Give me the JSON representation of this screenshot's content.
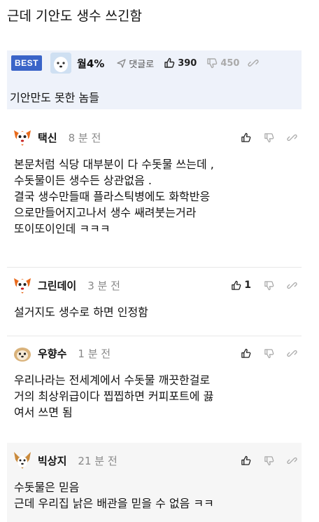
{
  "post": {
    "title": "근데 기안도 생수 쓰긴함"
  },
  "best": {
    "badge": "BEST",
    "nickname": "월4%",
    "reply_label": "댓글로",
    "upvotes": "390",
    "downvotes": "450",
    "body": "기안만도 못한 놈들"
  },
  "comments": [
    {
      "nickname": "택신",
      "time": "8 분 전",
      "upvotes": "",
      "lines": [
        "본문처럼 식당 대부분이 다 수돗물 쓰는데 ,",
        "수돗물이든 생수든 상관없음 .",
        "결국 생수만들때 플라스틱병에도 화학반응",
        "으로만들어지고나서 생수 쌔려붓는거라",
        "또이또이인데 ㅋㅋㅋ"
      ]
    },
    {
      "nickname": "그린데이",
      "time": "3 분 전",
      "upvotes": "1",
      "lines": [
        "설거지도 생수로 하면 인정함"
      ]
    },
    {
      "nickname": "우향수",
      "time": "1 분 전",
      "upvotes": "",
      "lines": [
        "우리나라는 전세계에서 수돗물 깨끗한걸로",
        "거의 최상위급이다 찝찝하면 커피포트에 끓",
        "여서 쓰면 됨"
      ]
    },
    {
      "nickname": "빅상지",
      "time": "21 분 전",
      "upvotes": "",
      "lines": [
        "수돗물은 믿음",
        "근데 우리집 낡은 배관을 믿을 수 없음 ㅋㅋ"
      ]
    }
  ],
  "icons": {
    "upvote": "thumbs-up-icon",
    "downvote": "thumbs-down-icon",
    "share": "share-icon",
    "reply": "reply-arrow-icon"
  },
  "colors": {
    "best_badge": "#3a64c8",
    "best_bg": "#eef2fa",
    "muted": "#888888"
  }
}
